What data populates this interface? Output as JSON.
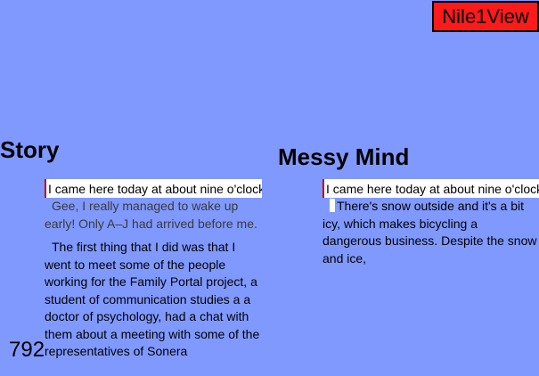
{
  "header": {
    "view_button_label": "Nile1View"
  },
  "story": {
    "title": "Story",
    "input_value": "I came here today at about nine o'clock",
    "paragraphs": [
      "Gee, I really managed to wake up early! Only A–J had arrived before me.",
      "The first thing that I did was that I went to meet some of the people working for the Family Portal project, a student of communication studies a a doctor of psychology, had a chat with them about a meeting with some of the representatives of Sonera"
    ]
  },
  "messy_mind": {
    "title": "Messy Mind",
    "input_value": "I came here today at about nine o'clock",
    "paragraphs": [
      "There's snow outside and it's a bit icy, which makes bicycling a dangerous business. Despite the snow and ice,"
    ]
  },
  "footer": {
    "page_number": "792"
  },
  "colors": {
    "background": "#8099ff",
    "badge": "#ff1a1a",
    "input_marker": "#c00000"
  }
}
